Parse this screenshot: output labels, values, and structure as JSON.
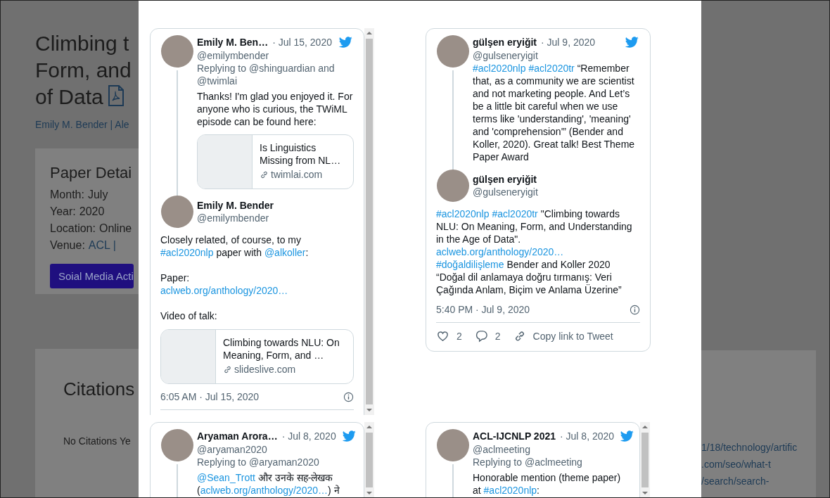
{
  "page": {
    "title_lines": [
      "Climbing t",
      "Form, and",
      "of Data"
    ],
    "authors": "Emily M. Bender | Ale",
    "details": {
      "heading": "Paper Detai",
      "rows": [
        {
          "label": "Month:",
          "value": "July",
          "kind": "text"
        },
        {
          "label": "Year:",
          "value": "2020",
          "kind": "text"
        },
        {
          "label": "Location:",
          "value": "Online",
          "kind": "text"
        },
        {
          "label": "Venue:",
          "value": "ACL |",
          "kind": "link"
        }
      ],
      "button": "Soial Media Acti"
    },
    "citations": {
      "heading": "Citations",
      "empty_text": "No Citations Ye",
      "links": [
        "1/18/technology/artific",
        ".com/seo/what-t",
        "/search/search-"
      ]
    }
  },
  "embeds": [
    {
      "scrollable": true,
      "posts": [
        {
          "kind": "reply",
          "name": "Emily M. Ben…",
          "date": "· Jul 15, 2020",
          "handle": "@emilymbender",
          "replying_to": "Replying to @shinguardian and @twimlai",
          "paragraphs": [
            [
              [
                {
                  "kind": "text",
                  "text": "Thanks! I'm glad you enjoyed it. For anyone who is curious, the TWiML episode can be found here:"
                }
              ]
            ]
          ],
          "card": {
            "title": "Is Linguistics Missing from NL…",
            "domain": "twimlai.com"
          }
        },
        {
          "kind": "main",
          "name": "Emily M. Bender",
          "handle": "@emilymbender",
          "paragraphs": [
            [
              [
                {
                  "kind": "text",
                  "text": "Closely related, of course, to my "
                },
                {
                  "kind": "hashtag",
                  "text": "#acl2020nlp"
                },
                {
                  "kind": "text",
                  "text": " paper with "
                },
                {
                  "kind": "mention",
                  "text": "@alkoller"
                },
                {
                  "kind": "text",
                  "text": ":"
                }
              ]
            ],
            [
              [
                {
                  "kind": "text",
                  "text": "Paper:"
                }
              ],
              [
                {
                  "kind": "url",
                  "text": "aclweb.org/anthology/2020…"
                }
              ]
            ],
            [
              [
                {
                  "kind": "text",
                  "text": "Video of talk:"
                }
              ]
            ]
          ],
          "card": {
            "title": "Climbing towards NLU: On Meaning, Form, and …",
            "domain": "slideslive.com"
          },
          "footer": {
            "time": "6:05 AM · Jul 15, 2020"
          }
        }
      ]
    },
    {
      "scrollable": false,
      "posts": [
        {
          "kind": "reply",
          "name": "gülşen eryiğit",
          "date": "· Jul 9, 2020",
          "handle": "@gulseneryigit",
          "paragraphs": [
            [
              [
                {
                  "kind": "hashtag",
                  "text": "#acl2020nlp "
                },
                {
                  "kind": "hashtag",
                  "text": "#acl2020tr"
                },
                {
                  "kind": "text",
                  "text": " “Remember that, as a community we are scientist and not marketing people. And Let’s be a little bit careful when we use terms like 'understanding', 'meaning' and 'comprehension'” (Bender and Koller, 2020). Great talk! Best Theme Paper Award"
                }
              ]
            ]
          ]
        },
        {
          "kind": "main",
          "name": "gülşen eryiğit",
          "handle": "@gulseneryigit",
          "paragraphs": [
            [
              [
                {
                  "kind": "hashtag",
                  "text": "#acl2020nlp "
                },
                {
                  "kind": "hashtag",
                  "text": "#acl2020tr"
                },
                {
                  "kind": "text",
                  "text": " \"Climbing towards NLU: On Meaning, Form, and Understanding in the Age of Data\"."
                }
              ],
              [
                {
                  "kind": "url",
                  "text": "aclweb.org/anthology/2020…"
                }
              ],
              [
                {
                  "kind": "hashtag",
                  "text": "#doğaldilişleme"
                },
                {
                  "kind": "text",
                  "text": "  Bender and Koller 2020 “Doğal dil anlamaya doğru tırmanış: Veri Çağında Anlam, Biçim ve Anlama Üzerine”"
                }
              ]
            ]
          ],
          "footer": {
            "time": "5:40 PM · Jul 9, 2020",
            "actions": [
              {
                "kind": "like",
                "label": "2"
              },
              {
                "kind": "reply",
                "label": "2"
              },
              {
                "kind": "copy",
                "label": "Copy link to Tweet"
              }
            ]
          }
        }
      ]
    },
    {
      "scrollable": true,
      "posts": [
        {
          "kind": "reply",
          "name": "Aryaman Arora…",
          "date": "· Jul 8, 2020",
          "handle": "@aryaman2020",
          "replying_to": "Replying to @aryaman2020",
          "paragraphs": [
            [
              [
                {
                  "kind": "mention",
                  "text": "@Sean_Trott"
                },
                {
                  "kind": "text",
                  "text": " और उनके सह-लेखक ("
                },
                {
                  "kind": "url",
                  "text": "aclweb.org/anthology/2020…"
                },
                {
                  "kind": "text",
                  "text": ") ने"
                }
              ]
            ]
          ]
        }
      ]
    },
    {
      "scrollable": true,
      "posts": [
        {
          "kind": "reply",
          "name": "ACL-IJCNLP 2021",
          "date": "· Jul 8, 2020",
          "handle": "@aclmeeting",
          "replying_to": "Replying to @aclmeeting",
          "paragraphs": [
            [
              [
                {
                  "kind": "text",
                  "text": "Honorable mention (theme paper) at "
                },
                {
                  "kind": "hashtag",
                  "text": "#acl2020nlp"
                },
                {
                  "kind": "text",
                  "text": ":"
                }
              ]
            ]
          ]
        }
      ]
    }
  ]
}
